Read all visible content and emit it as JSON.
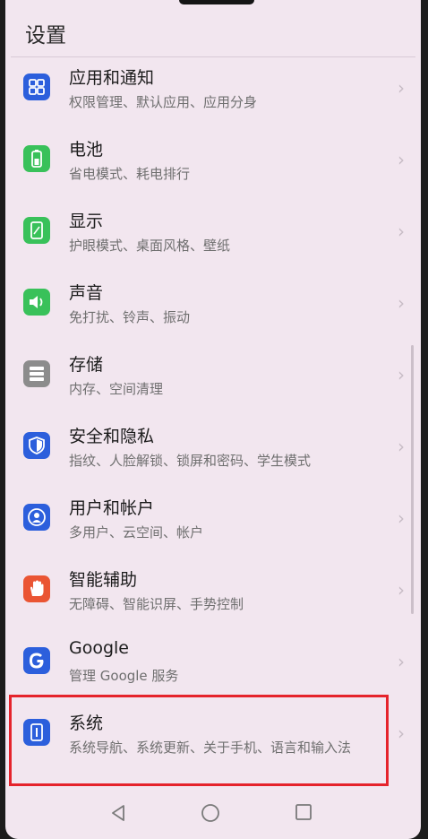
{
  "header": {
    "title": "设置"
  },
  "colors": {
    "blue": "#2c5fdc",
    "green": "#39c15a",
    "red": "#ea5533",
    "gray": "#8c8c8c",
    "highlight": "#e5232b"
  },
  "settings": [
    {
      "title": "应用和通知",
      "subtitle": "权限管理、默认应用、应用分身",
      "icon": "apps-grid-icon",
      "color": "#2c5fdc"
    },
    {
      "title": "电池",
      "subtitle": "省电模式、耗电排行",
      "icon": "battery-icon",
      "color": "#39c15a"
    },
    {
      "title": "显示",
      "subtitle": "护眼模式、桌面风格、壁纸",
      "icon": "display-icon",
      "color": "#39c15a"
    },
    {
      "title": "声音",
      "subtitle": "免打扰、铃声、振动",
      "icon": "speaker-icon",
      "color": "#39c15a"
    },
    {
      "title": "存储",
      "subtitle": "内存、空间清理",
      "icon": "storage-icon",
      "color": "#8c8c8c"
    },
    {
      "title": "安全和隐私",
      "subtitle": "指纹、人脸解锁、锁屏和密码、学生模式",
      "icon": "shield-icon",
      "color": "#2c5fdc"
    },
    {
      "title": "用户和帐户",
      "subtitle": "多用户、云空间、帐户",
      "icon": "user-icon",
      "color": "#2c5fdc"
    },
    {
      "title": "智能辅助",
      "subtitle": "无障碍、智能识屏、手势控制",
      "icon": "hand-icon",
      "color": "#ea5533"
    },
    {
      "title": "Google",
      "subtitle": "管理 Google 服务",
      "icon": "google-icon",
      "color": "#2c5fdc"
    },
    {
      "title": "系统",
      "subtitle": "系统导航、系统更新、关于手机、语言和输入法",
      "icon": "phone-info-icon",
      "color": "#2c5fdc"
    }
  ],
  "navbar": {
    "back": "back-icon",
    "home": "home-icon",
    "recents": "recents-icon"
  }
}
